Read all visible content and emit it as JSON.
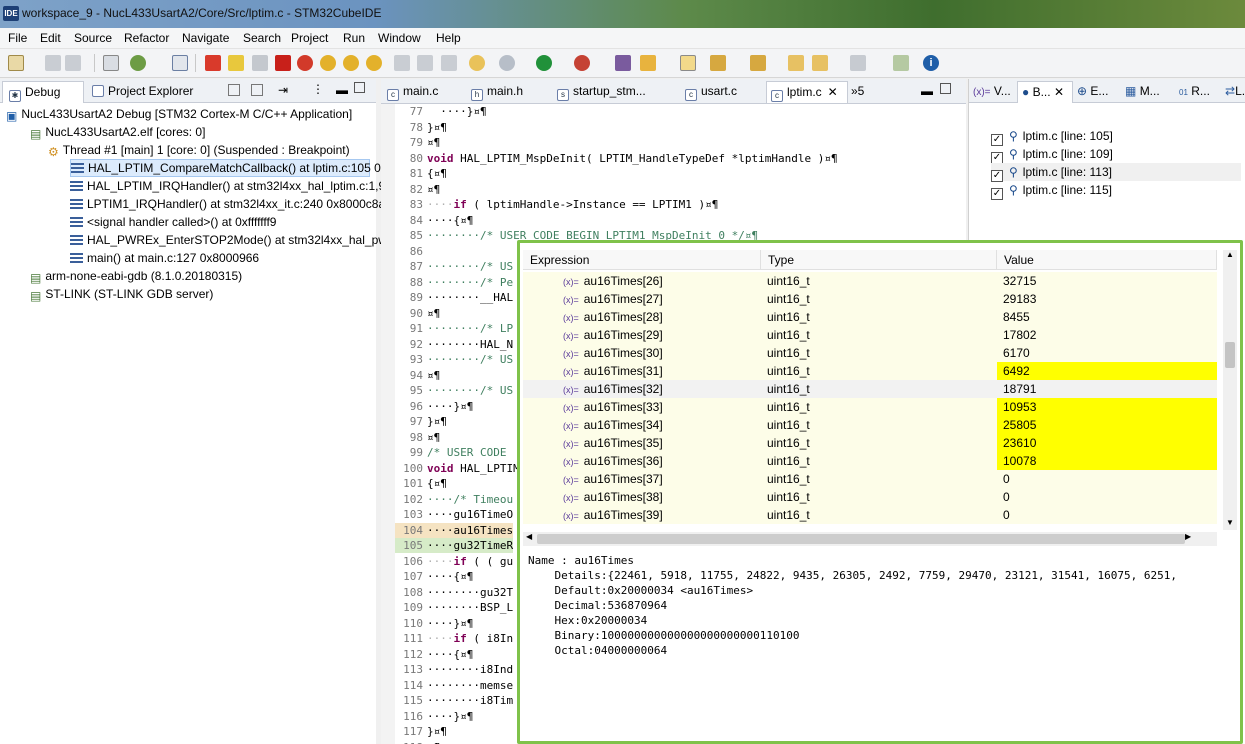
{
  "window": {
    "title": "workspace_9 - NucL433UsartA2/Core/Src/lptim.c - STM32CubeIDE",
    "icon": "IDE"
  },
  "menu": [
    "File",
    "Edit",
    "Source",
    "Refactor",
    "Navigate",
    "Search",
    "Project",
    "Run",
    "Window",
    "Help"
  ],
  "left_tabs": [
    {
      "label": "Debug"
    },
    {
      "label": "Project Explorer"
    }
  ],
  "debug_tree": [
    {
      "text": "NucL433UsartA2 Debug [STM32 Cortex-M C/C++ Application]",
      "level": 0
    },
    {
      "text": "NucL433UsartA2.elf [cores: 0]",
      "level": 1
    },
    {
      "text": "Thread #1 [main] 1 [core: 0] (Suspended : Breakpoint)",
      "level": 2
    },
    {
      "text": "HAL_LPTIM_CompareMatchCallback() at lptim.c:105 0",
      "level": 3,
      "selected": true
    },
    {
      "text": "HAL_LPTIM_IRQHandler() at stm32l4xx_hal_lptim.c:1,9",
      "level": 3
    },
    {
      "text": "LPTIM1_IRQHandler() at stm32l4xx_it.c:240 0x8000c8a",
      "level": 3
    },
    {
      "text": "<signal handler called>() at 0xfffffff9",
      "level": 3
    },
    {
      "text": "HAL_PWREx_EnterSTOP2Mode() at stm32l4xx_hal_pwr",
      "level": 3
    },
    {
      "text": "main() at main.c:127 0x8000966",
      "level": 3
    },
    {
      "text": "arm-none-eabi-gdb (8.1.0.20180315)",
      "level": 1
    },
    {
      "text": "ST-LINK (ST-LINK GDB server)",
      "level": 1
    }
  ],
  "editor_tabs": [
    {
      "label": "main.c"
    },
    {
      "label": "main.h"
    },
    {
      "label": "startup_stm..."
    },
    {
      "label": "usart.c"
    },
    {
      "label": "lptim.c",
      "active": true
    },
    {
      "label": "»5"
    }
  ],
  "right_tabs": [
    {
      "label": "V..."
    },
    {
      "label": "B..."
    },
    {
      "label": "E..."
    },
    {
      "label": "M..."
    },
    {
      "label": "R..."
    },
    {
      "label": "L..."
    }
  ],
  "breakpoints": [
    "lptim.c [line: 105]",
    "lptim.c [line: 109]",
    "lptim.c [line: 113]",
    "lptim.c [line: 115]"
  ],
  "code_lines": [
    {
      "n": "77",
      "t": "  ····}¤¶"
    },
    {
      "n": "78",
      "t": "}¤¶"
    },
    {
      "n": "79",
      "t": "¤¶"
    },
    {
      "n": "80",
      "t": "void HAL_LPTIM_MspDeInit( LPTIM_HandleTypeDef *lptimHandle )¤¶"
    },
    {
      "n": "81",
      "t": "{¤¶"
    },
    {
      "n": "82",
      "t": "¤¶"
    },
    {
      "n": "83",
      "t": "····if ( lptimHandle->Instance == LPTIM1 )¤¶"
    },
    {
      "n": "84",
      "t": "····{¤¶"
    },
    {
      "n": "85",
      "t": "········/* USER CODE BEGIN LPTIM1_MspDeInit 0 */¤¶"
    },
    {
      "n": "86",
      "t": ""
    },
    {
      "n": "87",
      "t": "········/* US"
    },
    {
      "n": "88",
      "t": "········/* Pe"
    },
    {
      "n": "89",
      "t": "········__HAL"
    },
    {
      "n": "90",
      "t": "¤¶"
    },
    {
      "n": "91",
      "t": "········/* LP"
    },
    {
      "n": "92",
      "t": "········HAL_N"
    },
    {
      "n": "93",
      "t": "········/* US"
    },
    {
      "n": "94",
      "t": "¤¶"
    },
    {
      "n": "95",
      "t": "········/* US"
    },
    {
      "n": "96",
      "t": "····}¤¶"
    },
    {
      "n": "97",
      "t": "}¤¶"
    },
    {
      "n": "98",
      "t": "¤¶"
    },
    {
      "n": "99",
      "t": "/* USER CODE"
    },
    {
      "n": "100",
      "t": "void HAL_LPTIM"
    },
    {
      "n": "101",
      "t": "{¤¶"
    },
    {
      "n": "102",
      "t": "····/* Timeou"
    },
    {
      "n": "103",
      "t": "····gu16TimeO"
    },
    {
      "n": "104",
      "t": "····au16Times"
    },
    {
      "n": "105",
      "t": "····gu32TimeR"
    },
    {
      "n": "106",
      "t": "····if ( ( gu"
    },
    {
      "n": "107",
      "t": "····{¤¶"
    },
    {
      "n": "108",
      "t": "········gu32T"
    },
    {
      "n": "109",
      "t": "········BSP_L"
    },
    {
      "n": "110",
      "t": "····}¤¶"
    },
    {
      "n": "111",
      "t": "····if ( i8In"
    },
    {
      "n": "112",
      "t": "····{¤¶"
    },
    {
      "n": "113",
      "t": "········i8Ind"
    },
    {
      "n": "114",
      "t": "········memse"
    },
    {
      "n": "115",
      "t": "········i8Tim"
    },
    {
      "n": "116",
      "t": "····}¤¶"
    },
    {
      "n": "117",
      "t": "}¤¶"
    },
    {
      "n": "118",
      "t": "¤¶"
    },
    {
      "n": "119",
      "t": "/* USER CODE"
    }
  ],
  "expr_popup": {
    "headers": {
      "expression": "Expression",
      "type": "Type",
      "value": "Value"
    },
    "rows": [
      {
        "expr": "au16Times[26]",
        "type": "uint16_t",
        "value": "32715",
        "changed": false
      },
      {
        "expr": "au16Times[27]",
        "type": "uint16_t",
        "value": "29183",
        "changed": false
      },
      {
        "expr": "au16Times[28]",
        "type": "uint16_t",
        "value": "8455",
        "changed": false
      },
      {
        "expr": "au16Times[29]",
        "type": "uint16_t",
        "value": "17802",
        "changed": false
      },
      {
        "expr": "au16Times[30]",
        "type": "uint16_t",
        "value": "6170",
        "changed": false
      },
      {
        "expr": "au16Times[31]",
        "type": "uint16_t",
        "value": "6492",
        "changed": true
      },
      {
        "expr": "au16Times[32]",
        "type": "uint16_t",
        "value": "18791",
        "changed": false,
        "selected": true
      },
      {
        "expr": "au16Times[33]",
        "type": "uint16_t",
        "value": "10953",
        "changed": true
      },
      {
        "expr": "au16Times[34]",
        "type": "uint16_t",
        "value": "25805",
        "changed": true
      },
      {
        "expr": "au16Times[35]",
        "type": "uint16_t",
        "value": "23610",
        "changed": true
      },
      {
        "expr": "au16Times[36]",
        "type": "uint16_t",
        "value": "10078",
        "changed": true
      },
      {
        "expr": "au16Times[37]",
        "type": "uint16_t",
        "value": "0",
        "changed": false
      },
      {
        "expr": "au16Times[38]",
        "type": "uint16_t",
        "value": "0",
        "changed": false
      },
      {
        "expr": "au16Times[39]",
        "type": "uint16_t",
        "value": "0",
        "changed": false
      }
    ],
    "details": [
      "Name : au16Times",
      "    Details:{22461, 5918, 11755, 24822, 9435, 26305, 2492, 7759, 29470, 23121, 31541, 16075, 6251,",
      "    Default:0x20000034 <au16Times>",
      "    Decimal:536870964",
      "    Hex:0x20000034",
      "    Binary:100000000000000000000000110100",
      "    Octal:04000000064"
    ]
  },
  "colors": {
    "changed_value": "#ffff00",
    "popup_border": "#7fc24a",
    "selected_frame": "#dcebfc",
    "keyword": "#7f0055",
    "comment": "#3f7f5f"
  }
}
